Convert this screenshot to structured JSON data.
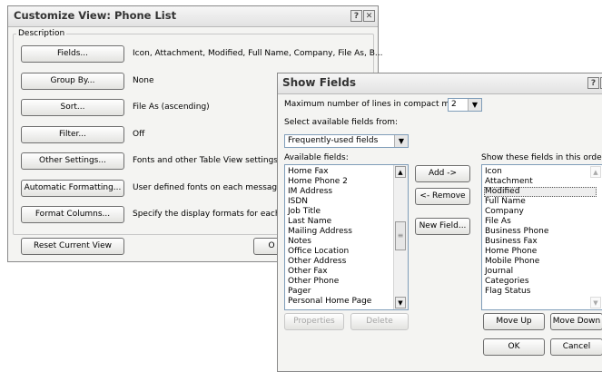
{
  "customize": {
    "title": "Customize View: Phone List",
    "help_glyph": "?",
    "close_glyph": "✕",
    "group_label": "Description",
    "rows": [
      {
        "button": "Fields...",
        "value": "Icon, Attachment, Modified, Full Name, Company, File As, B..."
      },
      {
        "button": "Group By...",
        "value": "None"
      },
      {
        "button": "Sort...",
        "value": "File As (ascending)"
      },
      {
        "button": "Filter...",
        "value": "Off"
      },
      {
        "button": "Other Settings...",
        "value": "Fonts and other Table View settings"
      },
      {
        "button": "Automatic Formatting...",
        "value": "User defined fonts on each message"
      },
      {
        "button": "Format Columns...",
        "value": "Specify the display formats for each fie"
      }
    ],
    "reset_label": "Reset Current View",
    "ok_partial": "O"
  },
  "show_fields": {
    "title": "Show Fields",
    "help_glyph": "?",
    "close_glyph": "✕",
    "max_lines_label": "Maximum number of lines in compact mode:",
    "max_lines_value": "2",
    "select_from_label": "Select available fields from:",
    "select_from_value": "Frequently-used fields",
    "available_label": "Available fields:",
    "available_fields": [
      "Home Fax",
      "Home Phone 2",
      "IM Address",
      "ISDN",
      "Job Title",
      "Last Name",
      "Mailing Address",
      "Notes",
      "Office Location",
      "Other Address",
      "Other Fax",
      "Other Phone",
      "Pager",
      "Personal Home Page"
    ],
    "add_label": "Add ->",
    "remove_label": "<- Remove",
    "new_field_label": "New Field...",
    "shown_label": "Show these fields in this order:",
    "shown_fields": [
      "Icon",
      "Attachment",
      "Modified",
      "Full Name",
      "Company",
      "File As",
      "Business Phone",
      "Business Fax",
      "Home Phone",
      "Mobile Phone",
      "Journal",
      "Categories",
      "Flag Status"
    ],
    "selected_field": "Modified",
    "properties_label": "Properties",
    "delete_label": "Delete",
    "move_up_label": "Move Up",
    "move_down_label": "Move Down",
    "ok_label": "OK",
    "cancel_label": "Cancel"
  },
  "icons": {
    "dropdown": "▼",
    "scroll_up": "▲",
    "scroll_down": "▼",
    "thumb_grip": "≡"
  }
}
